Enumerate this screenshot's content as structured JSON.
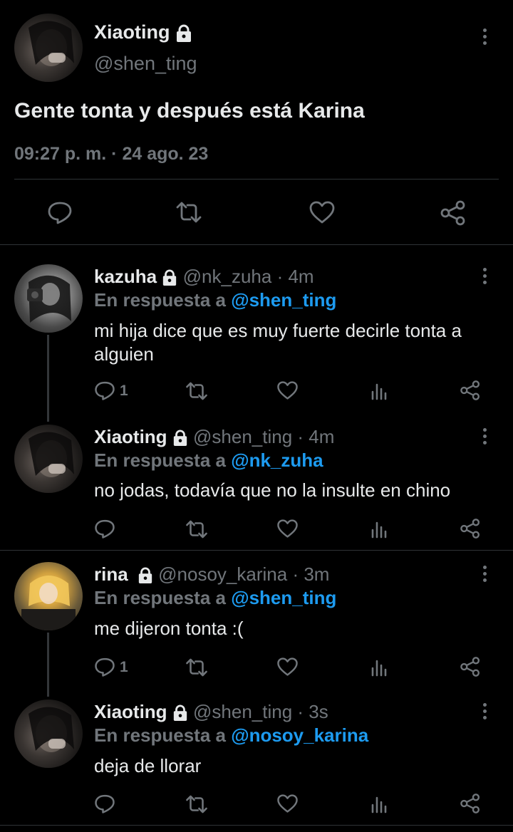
{
  "main_tweet": {
    "name": "Xiaoting",
    "handle": "@shen_ting",
    "text": "Gente tonta y después está Karina",
    "timestamp": "09:27 p. m. · 24 ago. 23"
  },
  "replies": [
    {
      "name": "kazuha",
      "handle": "@nk_zuha",
      "time": "· 4m",
      "reply_prefix": "En respuesta a",
      "reply_to": "@shen_ting",
      "text": "mi hija dice que es muy fuerte decirle tonta a alguien",
      "reply_count": "1"
    },
    {
      "name": "Xiaoting",
      "handle": "@shen_ting",
      "time": "· 4m",
      "reply_prefix": "En respuesta a",
      "reply_to": "@nk_zuha",
      "text": "no jodas, todavía que no la insulte en chino",
      "reply_count": ""
    },
    {
      "name": "rina",
      "handle": "@nosoy_karina",
      "time": "· 3m",
      "reply_prefix": "En respuesta a",
      "reply_to": "@shen_ting",
      "text": "me dijeron tonta :(",
      "reply_count": "1"
    },
    {
      "name": "Xiaoting",
      "handle": "@shen_ting",
      "time": "· 3s",
      "reply_prefix": "En respuesta a",
      "reply_to": "@nosoy_karina",
      "text": "deja de llorar",
      "reply_count": ""
    }
  ],
  "colors": {
    "background": "#000000",
    "text": "#e7e9ea",
    "secondary": "#71767b",
    "link": "#1d9bf0",
    "divider": "#2f3336"
  },
  "icons": [
    "lock-icon",
    "more-icon",
    "reply-icon",
    "retweet-icon",
    "like-icon",
    "views-icon",
    "share-icon"
  ]
}
